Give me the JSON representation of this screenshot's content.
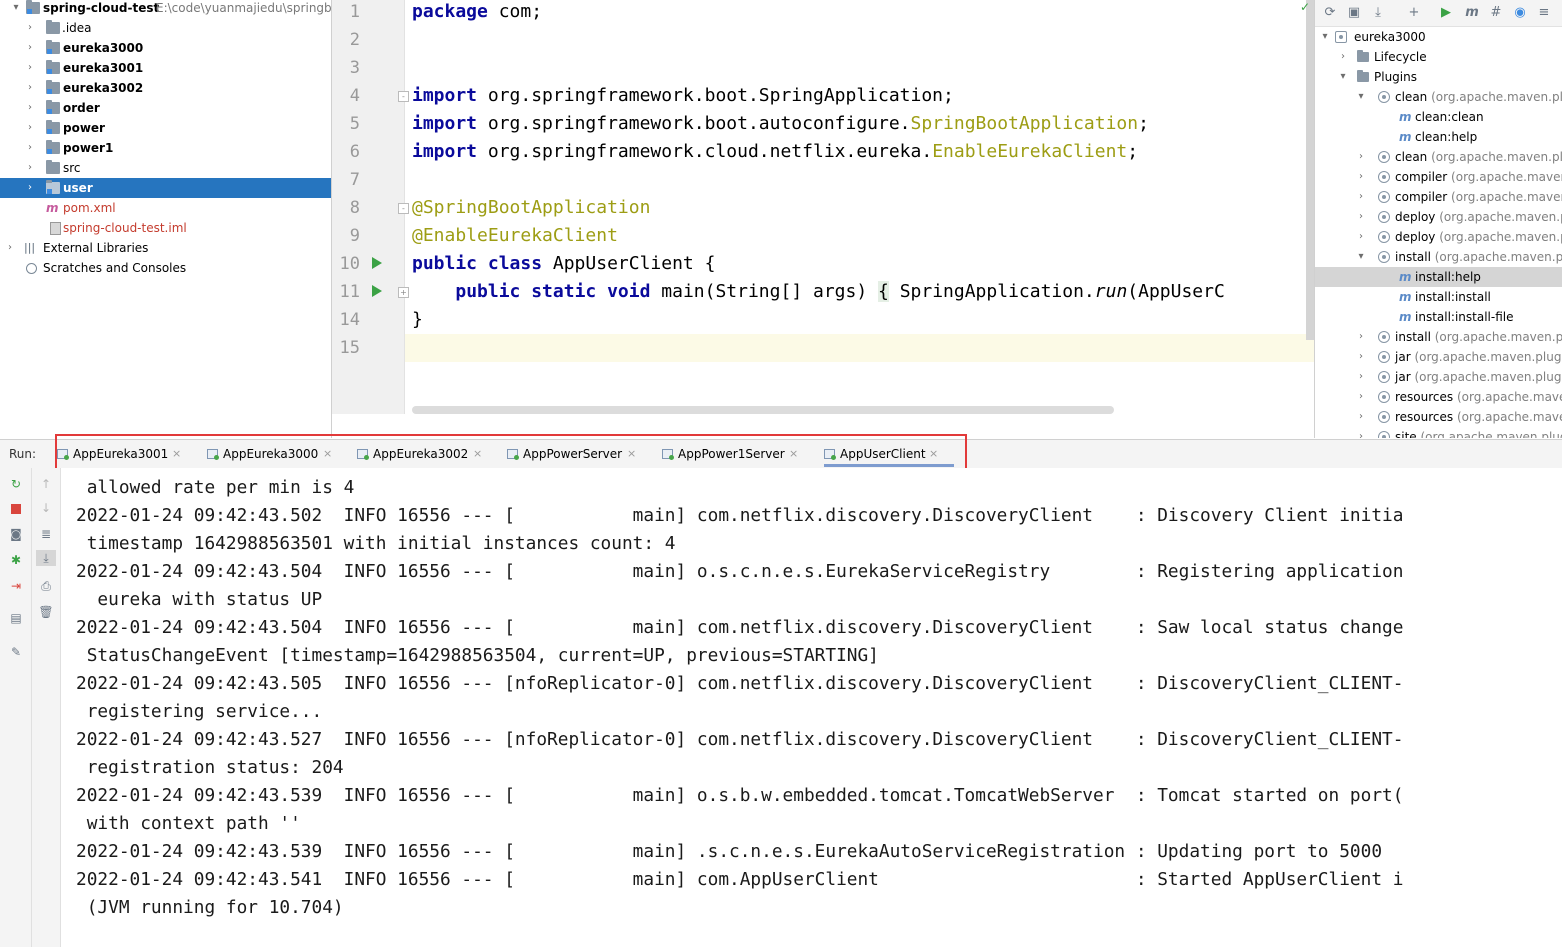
{
  "project": {
    "root_name": "spring-cloud-test",
    "root_path": "E:\\code\\yuanmajiedu\\springbo",
    "items": [
      {
        "label": "idea_dir",
        "text": ".idea"
      },
      {
        "label": "eureka3000",
        "text": "eureka3000"
      },
      {
        "label": "eureka3001",
        "text": "eureka3001"
      },
      {
        "label": "eureka3002",
        "text": "eureka3002"
      },
      {
        "label": "order",
        "text": "order"
      },
      {
        "label": "power",
        "text": "power"
      },
      {
        "label": "power1",
        "text": "power1"
      },
      {
        "label": "src",
        "text": "src"
      },
      {
        "label": "user",
        "text": "user"
      },
      {
        "label": "pom",
        "text": "pom.xml"
      },
      {
        "label": "iml",
        "text": "spring-cloud-test.iml"
      }
    ],
    "external_libraries": "External Libraries",
    "scratches": "Scratches and Consoles"
  },
  "editor": {
    "line_numbers": [
      "1",
      "2",
      "3",
      "4",
      "5",
      "6",
      "7",
      "8",
      "9",
      "10",
      "11",
      "14",
      "15"
    ],
    "l1_kw": "package",
    "l1_rest": " com;",
    "import_kw": "import",
    "l4_rest": " org.springframework.boot.SpringApplication;",
    "l5_pre": " org.springframework.boot.autoconfigure.",
    "l5_ann": "SpringBootApplication",
    "l5_end": ";",
    "l6_pre": " org.springframework.cloud.netflix.eureka.",
    "l6_ann": "EnableEurekaClient",
    "l6_end": ";",
    "l8": "@SpringBootApplication",
    "l9": "@EnableEurekaClient",
    "l10_kw": "public class",
    "l10_rest": " AppUserClient {",
    "l11_indent": "    ",
    "l11_kw": "public static void",
    "l11_mid": " main(String[] args) ",
    "l11_brace": "{",
    "l11_pre": " SpringApplication.",
    "l11_run": "run",
    "l11_end": "(AppUserC",
    "l14": "}"
  },
  "maven": {
    "root": "eureka3000",
    "lifecycle": "Lifecycle",
    "plugins": "Plugins",
    "rows": [
      {
        "name": "clean",
        "detail": " (org.apache.maven.plug"
      },
      {
        "goal": "clean:clean"
      },
      {
        "goal": "clean:help"
      },
      {
        "name": "clean",
        "detail": " (org.apache.maven.plug"
      },
      {
        "name": "compiler",
        "detail": " (org.apache.maven."
      },
      {
        "name": "compiler",
        "detail": " (org.apache.maven."
      },
      {
        "name": "deploy",
        "detail": " (org.apache.maven.pl"
      },
      {
        "name": "deploy",
        "detail": " (org.apache.maven.pl"
      },
      {
        "name": "install",
        "detail": " (org.apache.maven.plu"
      },
      {
        "goal": "install:help"
      },
      {
        "goal": "install:install"
      },
      {
        "goal": "install:install-file"
      },
      {
        "name": "install",
        "detail": " (org.apache.maven.plu"
      },
      {
        "name": "jar",
        "detail": " (org.apache.maven.plugin"
      },
      {
        "name": "jar",
        "detail": " (org.apache.maven.plugin"
      },
      {
        "name": "resources",
        "detail": " (org.apache.maver"
      },
      {
        "name": "resources",
        "detail": " (org.apache.maver"
      },
      {
        "name": "site",
        "detail": " (org.apache.maven.plugi"
      }
    ]
  },
  "run": {
    "label": "Run:",
    "tabs": [
      "AppEureka3001",
      "AppEureka3000",
      "AppEureka3002",
      "AppPowerServer",
      "AppPower1Server",
      "AppUserClient"
    ],
    "close_glyph": "×"
  },
  "console": {
    "lines": [
      " allowed rate per min is 4",
      "2022-01-24 09:42:43.502  INFO 16556 --- [           main] com.netflix.discovery.DiscoveryClient    : Discovery Client initia",
      " timestamp 1642988563501 with initial instances count: 4",
      "2022-01-24 09:42:43.504  INFO 16556 --- [           main] o.s.c.n.e.s.EurekaServiceRegistry        : Registering application",
      "  eureka with status UP",
      "2022-01-24 09:42:43.504  INFO 16556 --- [           main] com.netflix.discovery.DiscoveryClient    : Saw local status change",
      " StatusChangeEvent [timestamp=1642988563504, current=UP, previous=STARTING]",
      "2022-01-24 09:42:43.505  INFO 16556 --- [nfoReplicator-0] com.netflix.discovery.DiscoveryClient    : DiscoveryClient_CLIENT-",
      " registering service...",
      "2022-01-24 09:42:43.527  INFO 16556 --- [nfoReplicator-0] com.netflix.discovery.DiscoveryClient    : DiscoveryClient_CLIENT-",
      " registration status: 204",
      "2022-01-24 09:42:43.539  INFO 16556 --- [           main] o.s.b.w.embedded.tomcat.TomcatWebServer  : Tomcat started on port(",
      " with context path ''",
      "2022-01-24 09:42:43.539  INFO 16556 --- [           main] .s.c.n.e.s.EurekaAutoServiceRegistration : Updating port to 5000",
      "2022-01-24 09:42:43.541  INFO 16556 --- [           main] com.AppUserClient                        : Started AppUserClient i",
      " (JVM running for 10.704)"
    ]
  },
  "colors": {
    "selection": "#2675bf",
    "keyword": "#0a0a9b",
    "annotation": "#9d9d14",
    "highlight_box": "#e23a3a",
    "run_green": "#3ba245"
  }
}
